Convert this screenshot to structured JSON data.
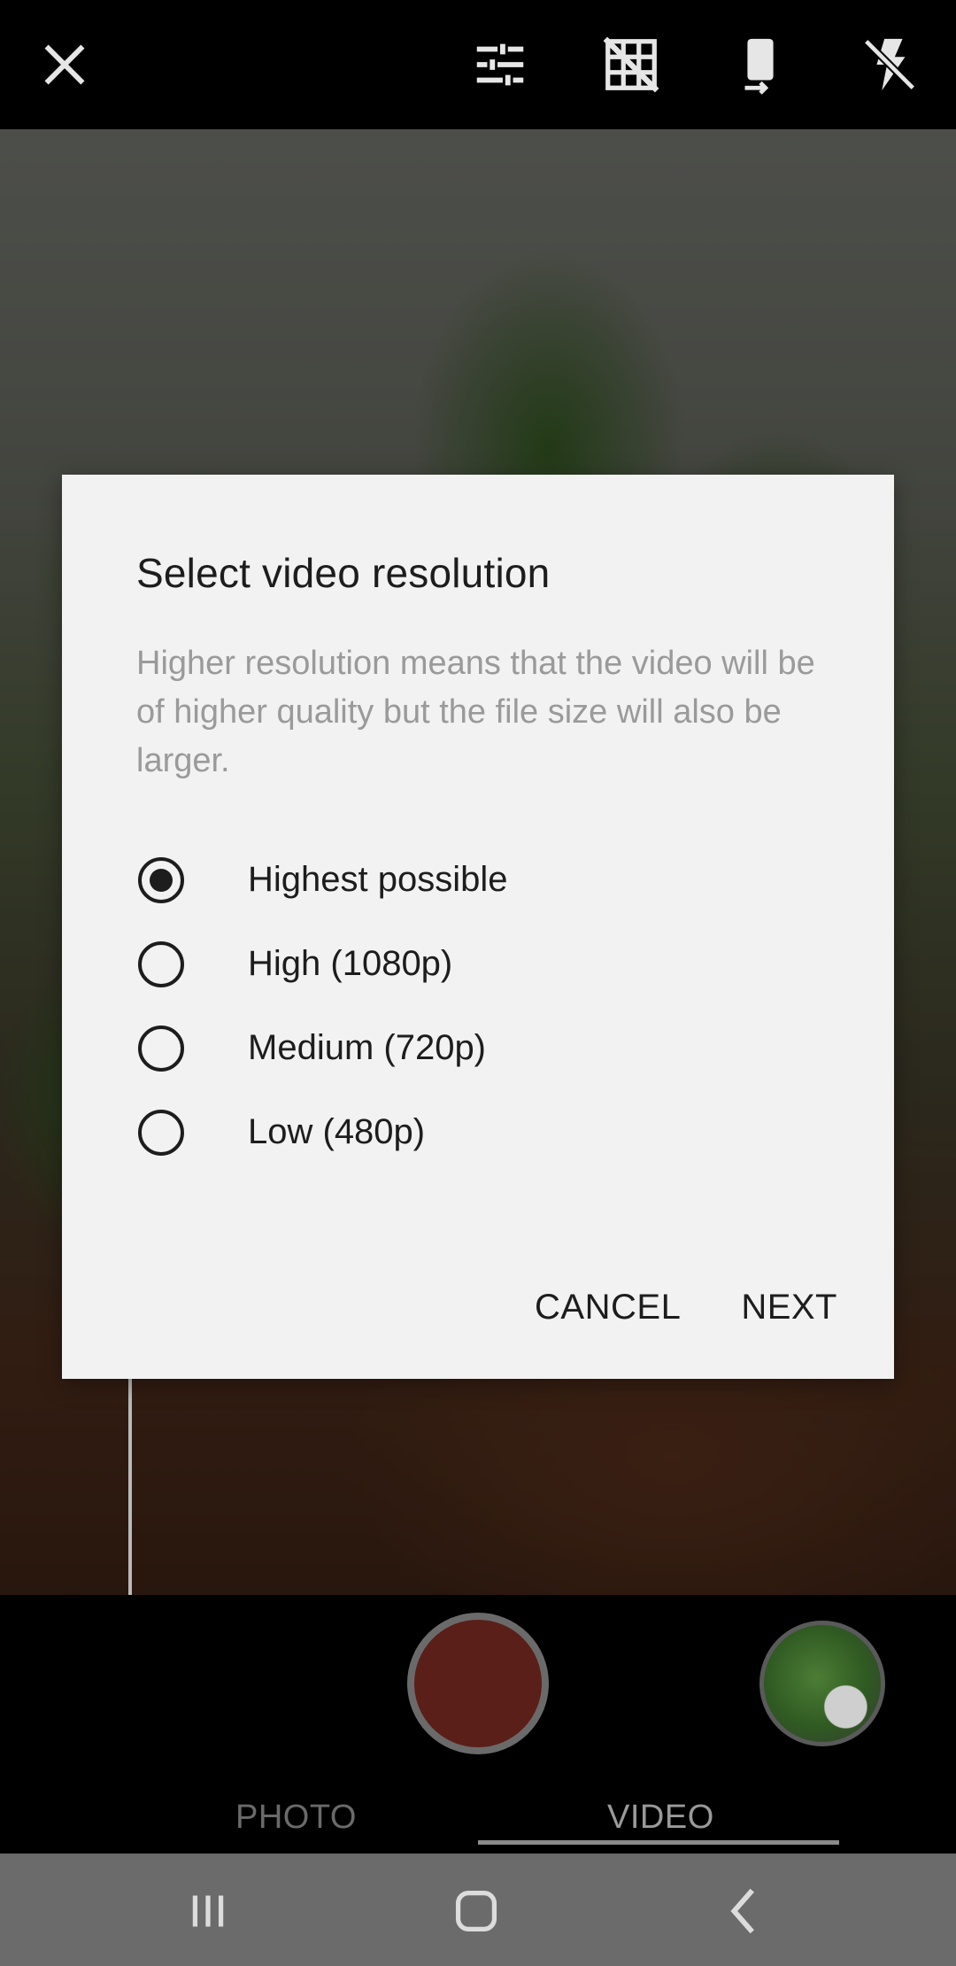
{
  "toolbar": {
    "icons": [
      "close-icon",
      "tune-sliders-icon",
      "grid-off-icon",
      "screen-rotation-icon",
      "flash-off-icon"
    ]
  },
  "dialog": {
    "title": "Select video resolution",
    "description": "Higher resolution means that the video will be of higher quality but the file size will also be larger.",
    "options": [
      {
        "label": "Highest possible",
        "selected": true
      },
      {
        "label": "High (1080p)",
        "selected": false
      },
      {
        "label": "Medium (720p)",
        "selected": false
      },
      {
        "label": "Low (480p)",
        "selected": false
      }
    ],
    "cancel_label": "CANCEL",
    "next_label": "NEXT"
  },
  "camera": {
    "modes": {
      "photo": "PHOTO",
      "video": "VIDEO"
    },
    "active_mode": "VIDEO",
    "shutter_color": "#5a1f18"
  },
  "navbar": {
    "icons": [
      "recent-apps-icon",
      "home-icon",
      "back-icon"
    ]
  }
}
